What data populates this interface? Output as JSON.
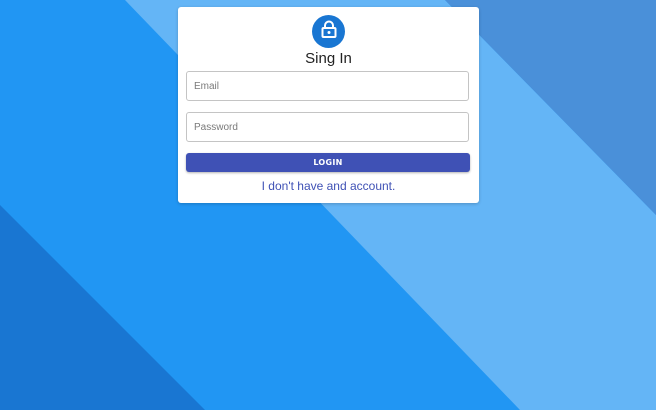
{
  "colors": {
    "background": "#2196f3",
    "stripe_light": "#64b5f6",
    "stripe_dark": "#1976d2",
    "stripe_mid": "#4a90d9",
    "lock_circle": "#1976d2",
    "button": "#3f51b5"
  },
  "form": {
    "icon": "lock-icon",
    "title": "Sing In",
    "email_placeholder": "Email",
    "password_placeholder": "Password",
    "login_label": "LOGIN",
    "signup_link": "I don't have and account."
  }
}
